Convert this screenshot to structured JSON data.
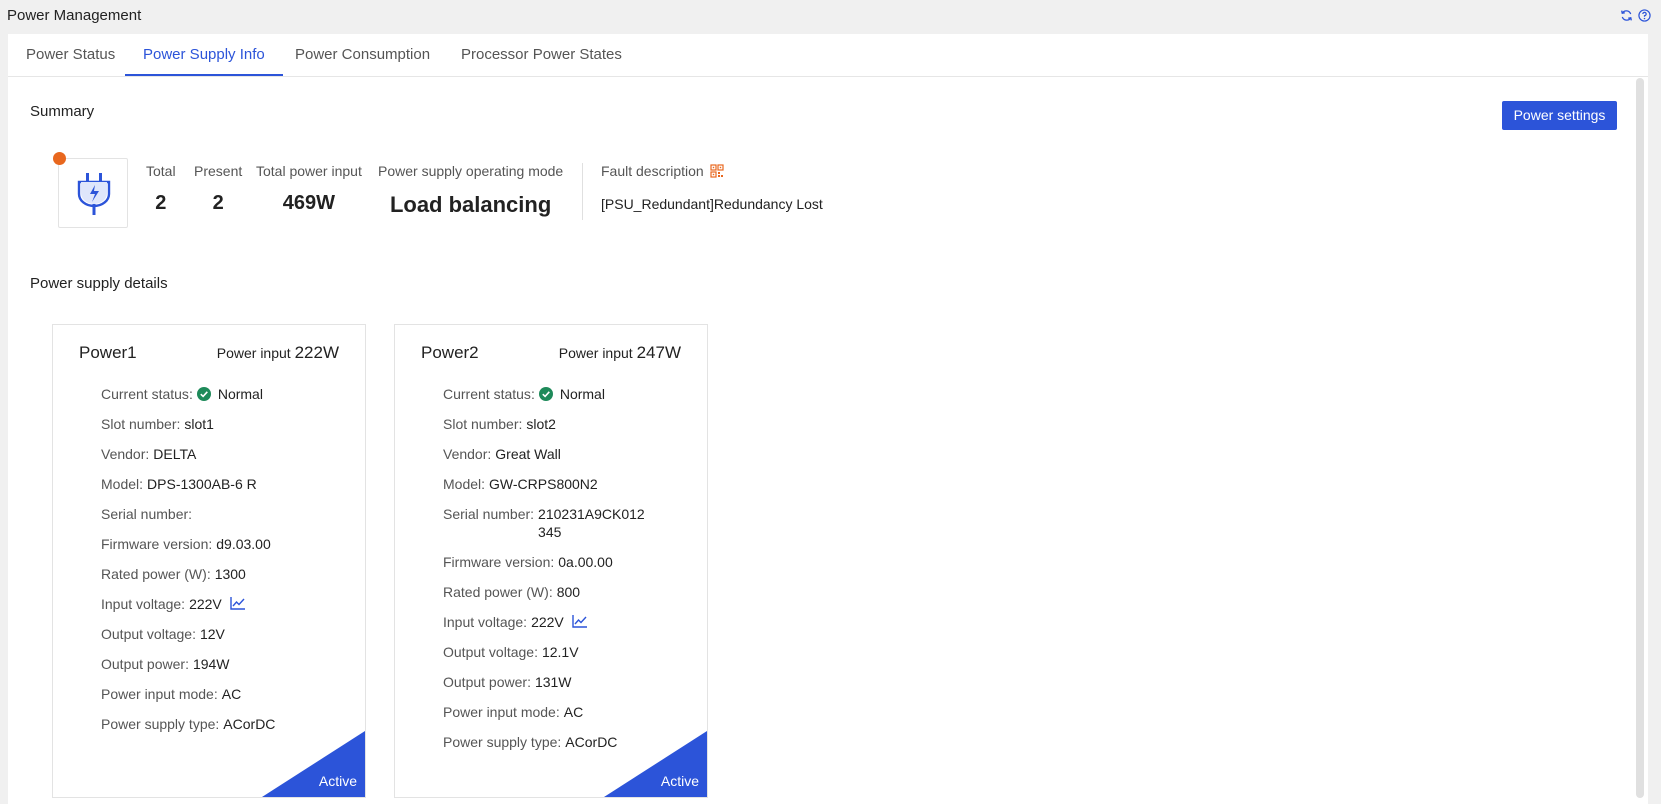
{
  "app": {
    "title": "Power Management"
  },
  "tabs": [
    {
      "label": "Power Status",
      "active": false
    },
    {
      "label": "Power Supply Info",
      "active": true
    },
    {
      "label": "Power Consumption",
      "active": false
    },
    {
      "label": "Processor Power States",
      "active": false
    }
  ],
  "summary": {
    "title": "Summary",
    "settings_button": "Power settings",
    "stats": [
      {
        "label": "Total",
        "value": "2"
      },
      {
        "label": "Present",
        "value": "2"
      },
      {
        "label": "Total power input",
        "value": "469W"
      },
      {
        "label": "Power supply operating mode",
        "value": "Load balancing"
      }
    ],
    "fault_label": "Fault description",
    "fault_text": "[PSU_Redundant]Redundancy Lost"
  },
  "details": {
    "title": "Power supply details",
    "cards": [
      {
        "name": "Power1",
        "input_label": "Power input",
        "input_value": "222W",
        "status_badge": "Active",
        "fields": {
          "current_status": {
            "label": "Current status",
            "value": "Normal"
          },
          "slot_number": {
            "label": "Slot number",
            "value": "slot1"
          },
          "vendor": {
            "label": "Vendor",
            "value": "DELTA"
          },
          "model": {
            "label": "Model",
            "value": "DPS-1300AB-6 R"
          },
          "serial_number": {
            "label": "Serial number",
            "value": ""
          },
          "firmware_version": {
            "label": "Firmware version",
            "value": "d9.03.00"
          },
          "rated_power": {
            "label": "Rated power (W)",
            "value": "1300"
          },
          "input_voltage": {
            "label": "Input voltage",
            "value": "222V"
          },
          "output_voltage": {
            "label": "Output voltage",
            "value": "12V"
          },
          "output_power": {
            "label": "Output power",
            "value": "194W"
          },
          "power_input_mode": {
            "label": "Power input mode",
            "value": "AC"
          },
          "power_supply_type": {
            "label": "Power supply type",
            "value": "ACorDC"
          }
        }
      },
      {
        "name": "Power2",
        "input_label": "Power input",
        "input_value": "247W",
        "status_badge": "Active",
        "fields": {
          "current_status": {
            "label": "Current status",
            "value": "Normal"
          },
          "slot_number": {
            "label": "Slot number",
            "value": "slot2"
          },
          "vendor": {
            "label": "Vendor",
            "value": "Great Wall"
          },
          "model": {
            "label": "Model",
            "value": "GW-CRPS800N2"
          },
          "serial_number": {
            "label": "Serial number",
            "value": "210231A9CK012345"
          },
          "firmware_version": {
            "label": "Firmware version",
            "value": "0a.00.00"
          },
          "rated_power": {
            "label": "Rated power (W)",
            "value": "800"
          },
          "input_voltage": {
            "label": "Input voltage",
            "value": "222V"
          },
          "output_voltage": {
            "label": "Output voltage",
            "value": "12.1V"
          },
          "output_power": {
            "label": "Output power",
            "value": "131W"
          },
          "power_input_mode": {
            "label": "Power input mode",
            "value": "AC"
          },
          "power_supply_type": {
            "label": "Power supply type",
            "value": "ACorDC"
          }
        }
      }
    ]
  },
  "colors": {
    "accent": "#2c54d9",
    "alert": "#e8671e",
    "ok": "#1e8a5a",
    "fault_icon": "#e8671e"
  },
  "icons": {
    "refresh": "refresh-icon",
    "help": "help-icon",
    "psu": "power-plug-icon",
    "fault": "qr-code-icon",
    "status_ok": "check-circle-icon",
    "chart": "line-chart-icon"
  }
}
